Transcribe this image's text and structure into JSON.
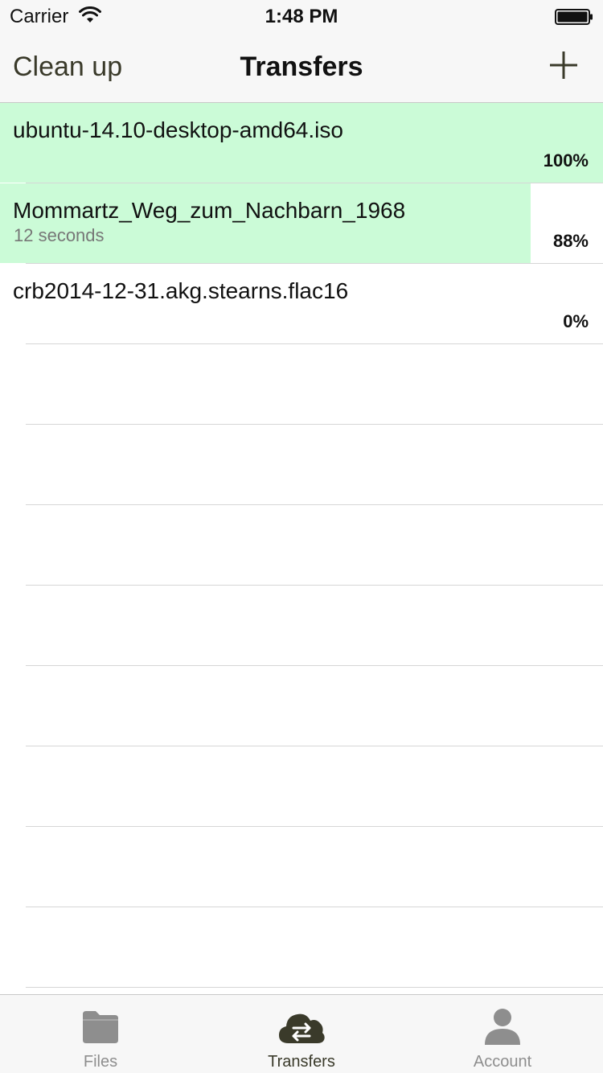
{
  "status_bar": {
    "carrier": "Carrier",
    "time": "1:48 PM"
  },
  "nav": {
    "left_button": "Clean up",
    "title": "Transfers",
    "right_icon": "plus-icon"
  },
  "transfers": [
    {
      "name": "ubuntu-14.10-desktop-amd64.iso",
      "subtitle": "",
      "percent_label": "100%",
      "progress": 1.0
    },
    {
      "name": "Mommartz_Weg_zum_Nachbarn_1968",
      "subtitle": "12 seconds",
      "percent_label": "88%",
      "progress": 0.88
    },
    {
      "name": "crb2014-12-31.akg.stearns.flac16",
      "subtitle": "",
      "percent_label": "0%",
      "progress": 0.0
    }
  ],
  "tabs": [
    {
      "label": "Files",
      "icon": "folder-icon",
      "active": false
    },
    {
      "label": "Transfers",
      "icon": "cloud-transfer-icon",
      "active": true
    },
    {
      "label": "Account",
      "icon": "person-icon",
      "active": false
    }
  ],
  "colors": {
    "progress_fill": "#cbfbd7",
    "tab_active": "#3a3a2a",
    "tab_inactive": "#8e8e8e"
  }
}
